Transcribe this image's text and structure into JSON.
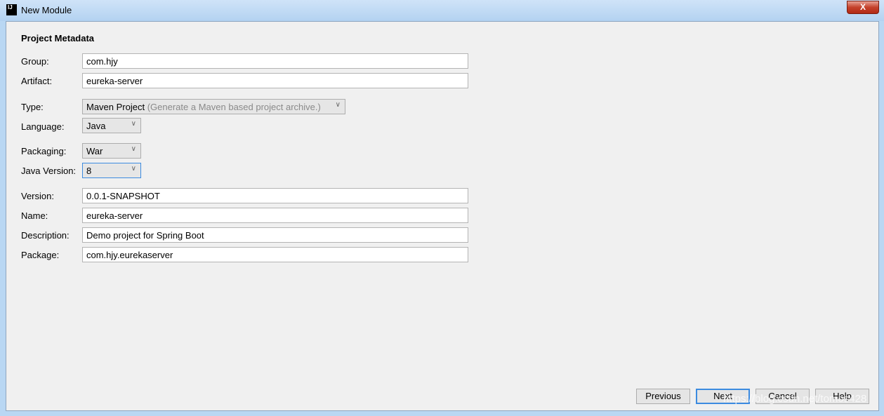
{
  "window": {
    "title": "New Module",
    "close_label": "X"
  },
  "section_title": "Project Metadata",
  "fields": {
    "group": {
      "label": "Group:",
      "value": "com.hjy"
    },
    "artifact": {
      "label": "Artifact:",
      "value": "eureka-server"
    },
    "type": {
      "label": "Type:",
      "value": "Maven Project",
      "hint": "(Generate a Maven based project archive.)"
    },
    "language": {
      "label": "Language:",
      "value": "Java"
    },
    "packaging": {
      "label": "Packaging:",
      "value": "War"
    },
    "java_version": {
      "label": "Java Version:",
      "value": "8"
    },
    "version": {
      "label": "Version:",
      "value": "0.0.1-SNAPSHOT"
    },
    "name": {
      "label": "Name:",
      "value": "eureka-server"
    },
    "description": {
      "label": "Description:",
      "value": "Demo project for Spring Boot"
    },
    "package": {
      "label": "Package:",
      "value": "com.hjy.eurekaserver"
    }
  },
  "buttons": {
    "previous": "Previous",
    "next": "Next",
    "cancel": "Cancel",
    "help": "Help"
  },
  "watermark": "https://blog.csdn.net/tomos428"
}
